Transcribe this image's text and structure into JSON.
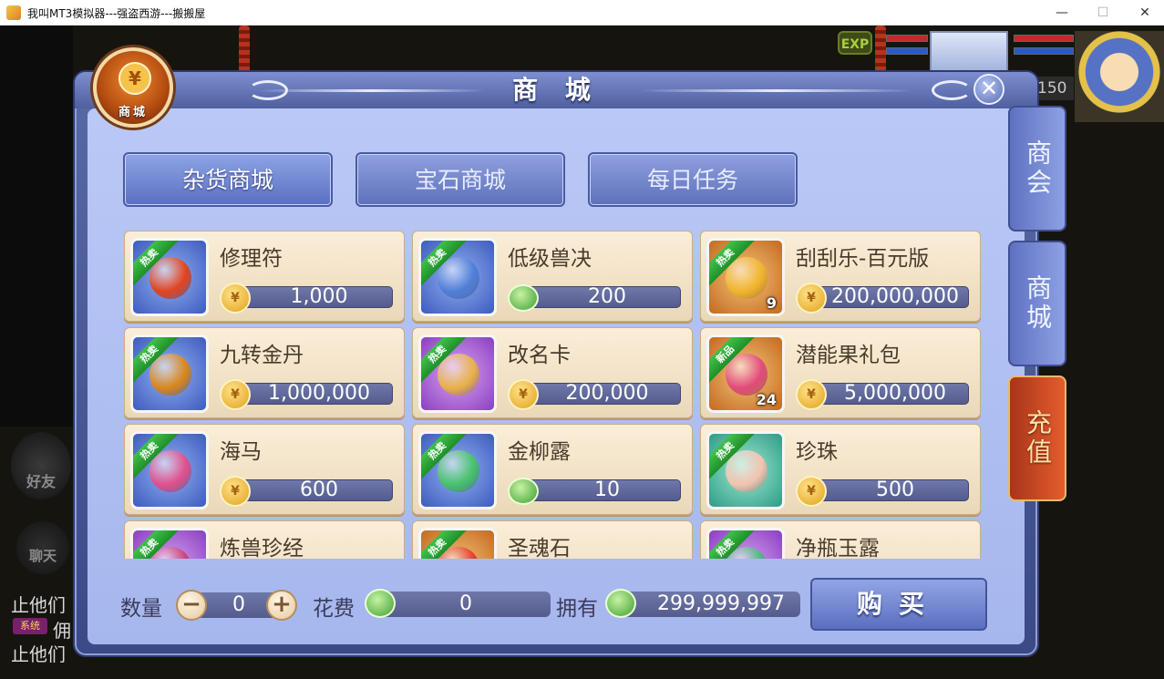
{
  "window": {
    "title": "我叫MT3模拟器---强盗西游---搬搬屋",
    "minimize": "—",
    "maximize": "☐",
    "close": "✕"
  },
  "hud": {
    "exp_badge": "EXP",
    "level": "150",
    "friend_label": "好友",
    "chat_label": "聊天",
    "chat_lines": [
      "止他们",
      "佣",
      "止他们"
    ],
    "system_badge": "系统"
  },
  "shop": {
    "title": "商 城",
    "emblem_label": "商城",
    "emblem_glyph": "¥",
    "close_glyph": "✕",
    "tabs": [
      {
        "label": "杂货商城",
        "active": true
      },
      {
        "label": "宝石商城",
        "active": false
      },
      {
        "label": "每日任务",
        "active": false
      }
    ],
    "side_tabs": [
      {
        "label": "商会"
      },
      {
        "label": "商城"
      },
      {
        "label": "充值"
      }
    ],
    "currency_glyph": "¥",
    "items": [
      {
        "name": "修理符",
        "price": "1,000",
        "currency": "gold",
        "tag": "热卖",
        "frame": "blue",
        "art": "#e2431f",
        "qty": ""
      },
      {
        "name": "低级兽决",
        "price": "200",
        "currency": "jade",
        "tag": "热卖",
        "frame": "blue",
        "art": "#4f7fd8",
        "qty": ""
      },
      {
        "name": "刮刮乐-百元版",
        "price": "200,000,000",
        "currency": "gold",
        "tag": "热卖",
        "frame": "orange",
        "art": "#f1b52c",
        "qty": "9"
      },
      {
        "name": "九转金丹",
        "price": "1,000,000",
        "currency": "gold",
        "tag": "热卖",
        "frame": "blue",
        "art": "#d9861d",
        "qty": ""
      },
      {
        "name": "改名卡",
        "price": "200,000",
        "currency": "gold",
        "tag": "热卖",
        "frame": "purple",
        "art": "#e8b14a",
        "qty": ""
      },
      {
        "name": "潜能果礼包",
        "price": "5,000,000",
        "currency": "gold",
        "tag": "新品",
        "frame": "orange",
        "art": "#e24a7a",
        "qty": "24"
      },
      {
        "name": "海马",
        "price": "600",
        "currency": "gold",
        "tag": "热卖",
        "frame": "blue",
        "art": "#e0508c",
        "qty": ""
      },
      {
        "name": "金柳露",
        "price": "10",
        "currency": "jade",
        "tag": "热卖",
        "frame": "blue",
        "art": "#47c26a",
        "qty": ""
      },
      {
        "name": "珍珠",
        "price": "500",
        "currency": "gold",
        "tag": "热卖",
        "frame": "teal",
        "art": "#f3c3b0",
        "qty": ""
      },
      {
        "name": "炼兽珍经",
        "price": "",
        "currency": "gold",
        "tag": "热卖",
        "frame": "purple",
        "art": "#c9437a",
        "qty": ""
      },
      {
        "name": "圣魂石",
        "price": "",
        "currency": "gold",
        "tag": "热卖",
        "frame": "orange",
        "art": "#e43c2c",
        "qty": ""
      },
      {
        "name": "净瓶玉露",
        "price": "",
        "currency": "gold",
        "tag": "热卖",
        "frame": "purple",
        "art": "#4cb57e",
        "qty": ""
      }
    ],
    "bottom": {
      "quantity_label": "数量",
      "quantity_value": "0",
      "minus": "−",
      "plus": "+",
      "cost_label": "花费",
      "cost_value": "0",
      "owned_label": "拥有",
      "owned_value": "299,999,997",
      "buy_label": "购买"
    }
  }
}
